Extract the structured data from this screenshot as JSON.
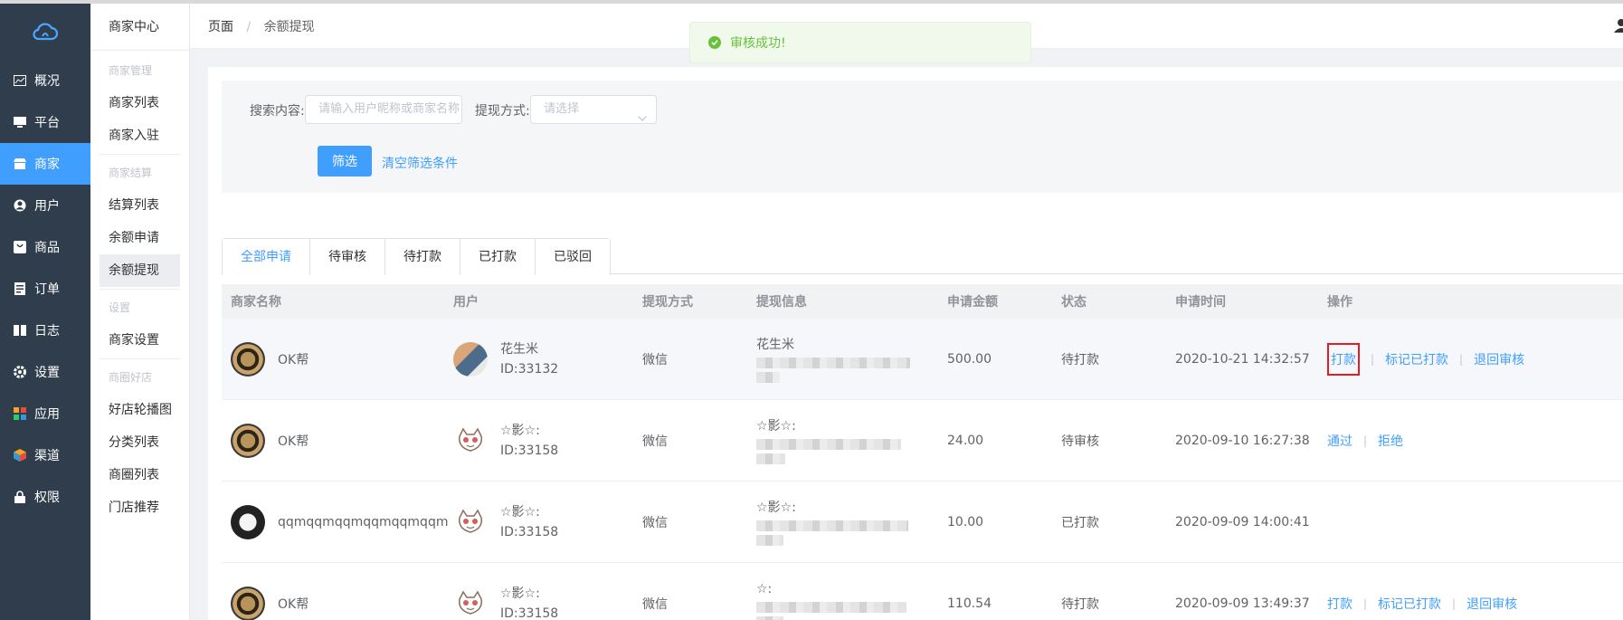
{
  "sidebar": {
    "items": [
      {
        "label": "概况",
        "icon": "chart-icon"
      },
      {
        "label": "平台",
        "icon": "monitor-icon"
      },
      {
        "label": "商家",
        "icon": "store-icon",
        "active": true
      },
      {
        "label": "用户",
        "icon": "user-icon"
      },
      {
        "label": "商品",
        "icon": "bag-icon"
      },
      {
        "label": "订单",
        "icon": "order-icon"
      },
      {
        "label": "日志",
        "icon": "log-icon"
      },
      {
        "label": "设置",
        "icon": "gear-icon"
      },
      {
        "label": "应用",
        "icon": "apps-icon"
      },
      {
        "label": "渠道",
        "icon": "cube-icon"
      },
      {
        "label": "权限",
        "icon": "lock-icon"
      }
    ]
  },
  "subnav": {
    "title": "商家中心",
    "groups": [
      {
        "title": "商家管理",
        "items": [
          "商家列表",
          "商家入驻"
        ]
      },
      {
        "title": "商家结算",
        "items": [
          "结算列表",
          "余额申请",
          "余额提现"
        ]
      },
      {
        "title": "设置",
        "items": [
          "商家设置"
        ]
      },
      {
        "title": "商圈好店",
        "items": [
          "好店轮播图",
          "分类列表",
          "商圈列表",
          "门店推荐"
        ]
      }
    ]
  },
  "breadcrumb": {
    "root": "页面",
    "separator": "/",
    "current": "余额提现"
  },
  "toast": {
    "message": "审核成功!"
  },
  "filter": {
    "search_label": "搜索内容:",
    "search_placeholder": "请输入用户昵称或商家名称",
    "method_label": "提现方式:",
    "method_placeholder": "请选择",
    "submit_label": "筛选",
    "clear_label": "清空筛选条件"
  },
  "tabs": [
    "全部申请",
    "待审核",
    "待打款",
    "已打款",
    "已驳回"
  ],
  "table": {
    "headers": [
      "商家名称",
      "用户",
      "提现方式",
      "提现信息",
      "申请金额",
      "状态",
      "申请时间",
      "操作"
    ],
    "rows": [
      {
        "merchant": "OK帮",
        "user_name": "花生米",
        "user_id": "ID:33132",
        "method": "微信",
        "info_name": "花生米",
        "amount": "500.00",
        "status": "待打款",
        "time": "2020-10-21 14:32:57",
        "actions": [
          "打款",
          "标记已打款",
          "退回审核"
        ]
      },
      {
        "merchant": "OK帮",
        "user_name": "☆影☆:",
        "user_id": "ID:33158",
        "method": "微信",
        "info_name": "☆影☆:",
        "amount": "24.00",
        "status": "待审核",
        "time": "2020-09-10 16:27:38",
        "actions": [
          "通过",
          "拒绝"
        ]
      },
      {
        "merchant": "qqmqqmqqmqqmqqmqqm",
        "user_name": "☆影☆:",
        "user_id": "ID:33158",
        "method": "微信",
        "info_name": "☆影☆:",
        "amount": "10.00",
        "status": "已打款",
        "time": "2020-09-09 14:00:41",
        "actions": []
      },
      {
        "merchant": "OK帮",
        "user_name": "☆影☆:",
        "user_id": "ID:33158",
        "method": "微信",
        "info_name": "☆:",
        "amount": "110.54",
        "status": "待打款",
        "time": "2020-09-09 13:49:37",
        "actions": [
          "打款",
          "标记已打款",
          "退回审核"
        ]
      }
    ]
  },
  "colors": {
    "primary": "#409eff",
    "sidebar": "#2f3d4c",
    "success": "#67c23a",
    "highlight": "#e51c23"
  }
}
